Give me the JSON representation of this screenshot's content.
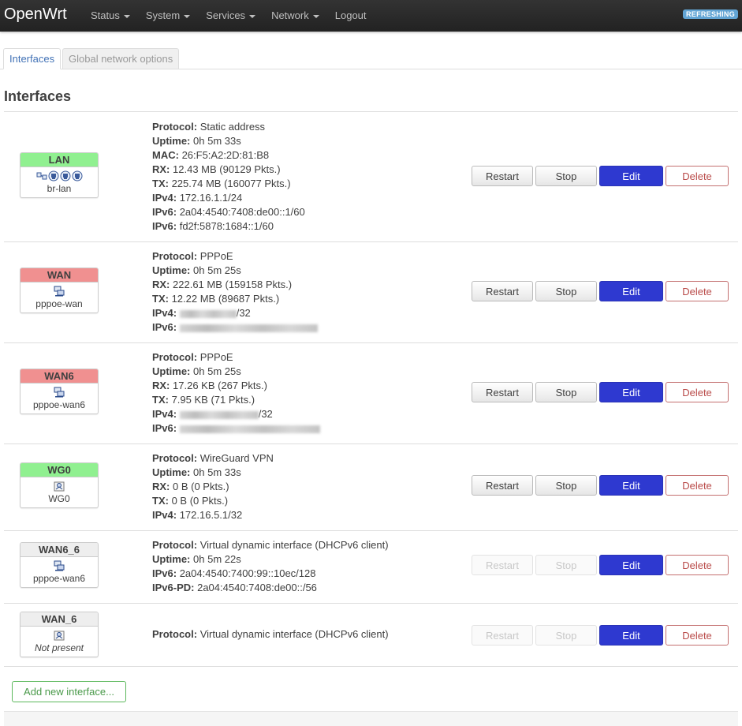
{
  "nav": {
    "brand": "OpenWrt",
    "menu": [
      {
        "label": "Status",
        "has_dropdown": true
      },
      {
        "label": "System",
        "has_dropdown": true
      },
      {
        "label": "Services",
        "has_dropdown": true
      },
      {
        "label": "Network",
        "has_dropdown": true
      },
      {
        "label": "Logout",
        "has_dropdown": false
      }
    ],
    "refresh_label": "REFRESHING"
  },
  "tabs": [
    {
      "label": "Interfaces",
      "active": true
    },
    {
      "label": "Global network options",
      "active": false
    }
  ],
  "section_title": "Interfaces",
  "interfaces": [
    {
      "name": "LAN",
      "color": "#90f090",
      "device": "br-lan",
      "device_italic": false,
      "icons": [
        "bridge-icon",
        "ethernet-port-icon",
        "ethernet-port-icon",
        "ethernet-port-icon"
      ],
      "info": [
        {
          "label": "Protocol:",
          "value": "Static address"
        },
        {
          "label": "Uptime:",
          "value": "0h 5m 33s"
        },
        {
          "label": "MAC:",
          "value": "26:F5:A2:2D:81:B8"
        },
        {
          "label": "RX:",
          "value": "12.43 MB (90129 Pkts.)"
        },
        {
          "label": "TX:",
          "value": "225.74 MB (160077 Pkts.)"
        },
        {
          "label": "IPv4:",
          "value": "172.16.1.1/24"
        },
        {
          "label": "IPv6:",
          "value": "2a04:4540:7408:de00::1/60"
        },
        {
          "label": "IPv6:",
          "value": "fd2f:5878:1684::1/60"
        }
      ],
      "buttons": {
        "restart": "Restart",
        "stop": "Stop",
        "edit": "Edit",
        "delete": "Delete"
      },
      "restart_enabled": true
    },
    {
      "name": "WAN",
      "color": "#f09090",
      "device": "pppoe-wan",
      "device_italic": false,
      "icons": [
        "network-device-icon"
      ],
      "info": [
        {
          "label": "Protocol:",
          "value": "PPPoE"
        },
        {
          "label": "Uptime:",
          "value": "0h 5m 25s"
        },
        {
          "label": "RX:",
          "value": "222.61 MB (159158 Pkts.)"
        },
        {
          "label": "TX:",
          "value": "12.22 MB (89687 Pkts.)"
        },
        {
          "label": "IPv4:",
          "value": "/32",
          "redacted_prefix": true
        },
        {
          "label": "IPv6:",
          "value": "",
          "redacted_prefix": true
        }
      ],
      "buttons": {
        "restart": "Restart",
        "stop": "Stop",
        "edit": "Edit",
        "delete": "Delete"
      },
      "restart_enabled": true
    },
    {
      "name": "WAN6",
      "color": "#f09090",
      "device": "pppoe-wan6",
      "device_italic": false,
      "icons": [
        "network-device-icon"
      ],
      "info": [
        {
          "label": "Protocol:",
          "value": "PPPoE"
        },
        {
          "label": "Uptime:",
          "value": "0h 5m 25s"
        },
        {
          "label": "RX:",
          "value": "17.26 KB (267 Pkts.)"
        },
        {
          "label": "TX:",
          "value": "7.95 KB (71 Pkts.)"
        },
        {
          "label": "IPv4:",
          "value": "/32",
          "redacted_prefix": true
        },
        {
          "label": "IPv6:",
          "value": "",
          "redacted_prefix": true
        }
      ],
      "buttons": {
        "restart": "Restart",
        "stop": "Stop",
        "edit": "Edit",
        "delete": "Delete"
      },
      "restart_enabled": true
    },
    {
      "name": "WG0",
      "color": "#90f090",
      "device": "WG0",
      "device_italic": false,
      "icons": [
        "tunnel-icon"
      ],
      "info": [
        {
          "label": "Protocol:",
          "value": "WireGuard VPN"
        },
        {
          "label": "Uptime:",
          "value": "0h 5m 33s"
        },
        {
          "label": "RX:",
          "value": "0 B (0 Pkts.)"
        },
        {
          "label": "TX:",
          "value": "0 B (0 Pkts.)"
        },
        {
          "label": "IPv4:",
          "value": "172.16.5.1/32"
        }
      ],
      "buttons": {
        "restart": "Restart",
        "stop": "Stop",
        "edit": "Edit",
        "delete": "Delete"
      },
      "restart_enabled": true
    },
    {
      "name": "WAN6_6",
      "color": "#eeeeee",
      "device": "pppoe-wan6",
      "device_italic": false,
      "icons": [
        "network-device-icon"
      ],
      "info": [
        {
          "label": "Protocol:",
          "value": "Virtual dynamic interface (DHCPv6 client)"
        },
        {
          "label": "Uptime:",
          "value": "0h 5m 22s"
        },
        {
          "label": "IPv6:",
          "value": "2a04:4540:7400:99::10ec/128"
        },
        {
          "label": "IPv6-PD:",
          "value": "2a04:4540:7408:de00::/56"
        }
      ],
      "buttons": {
        "restart": "Restart",
        "stop": "Stop",
        "edit": "Edit",
        "delete": "Delete"
      },
      "restart_enabled": false
    },
    {
      "name": "WAN_6",
      "color": "#eeeeee",
      "device": "Not present",
      "device_italic": true,
      "icons": [
        "tunnel-icon"
      ],
      "info": [
        {
          "label": "Protocol:",
          "value": "Virtual dynamic interface (DHCPv6 client)"
        }
      ],
      "buttons": {
        "restart": "Restart",
        "stop": "Stop",
        "edit": "Edit",
        "delete": "Delete"
      },
      "restart_enabled": false
    }
  ],
  "add_button": "Add new interface..."
}
